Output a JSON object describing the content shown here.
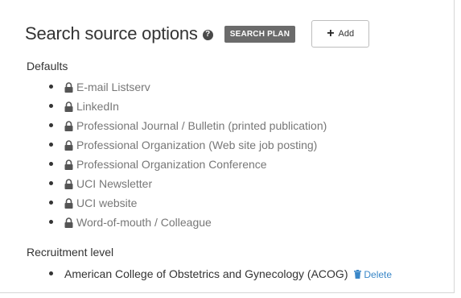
{
  "header": {
    "title": "Search source options",
    "help_icon": "question-circle-icon",
    "badge": "SEARCH PLAN",
    "add_label": "Add"
  },
  "defaults": {
    "title": "Defaults",
    "items": [
      "E-mail Listserv",
      "LinkedIn",
      "Professional Journal / Bulletin (printed publication)",
      "Professional Organization (Web site job posting)",
      "Professional Organization Conference",
      "UCI Newsletter",
      "UCI website",
      "Word-of-mouth / Colleague"
    ]
  },
  "recruitment": {
    "title": "Recruitment level",
    "items": [
      {
        "label": "American College of Obstetrics and Gynecology (ACOG)",
        "delete_label": "Delete"
      }
    ]
  },
  "colors": {
    "link": "#3a87c8",
    "badge_bg": "#6b6b6b",
    "muted_text": "#777777"
  }
}
